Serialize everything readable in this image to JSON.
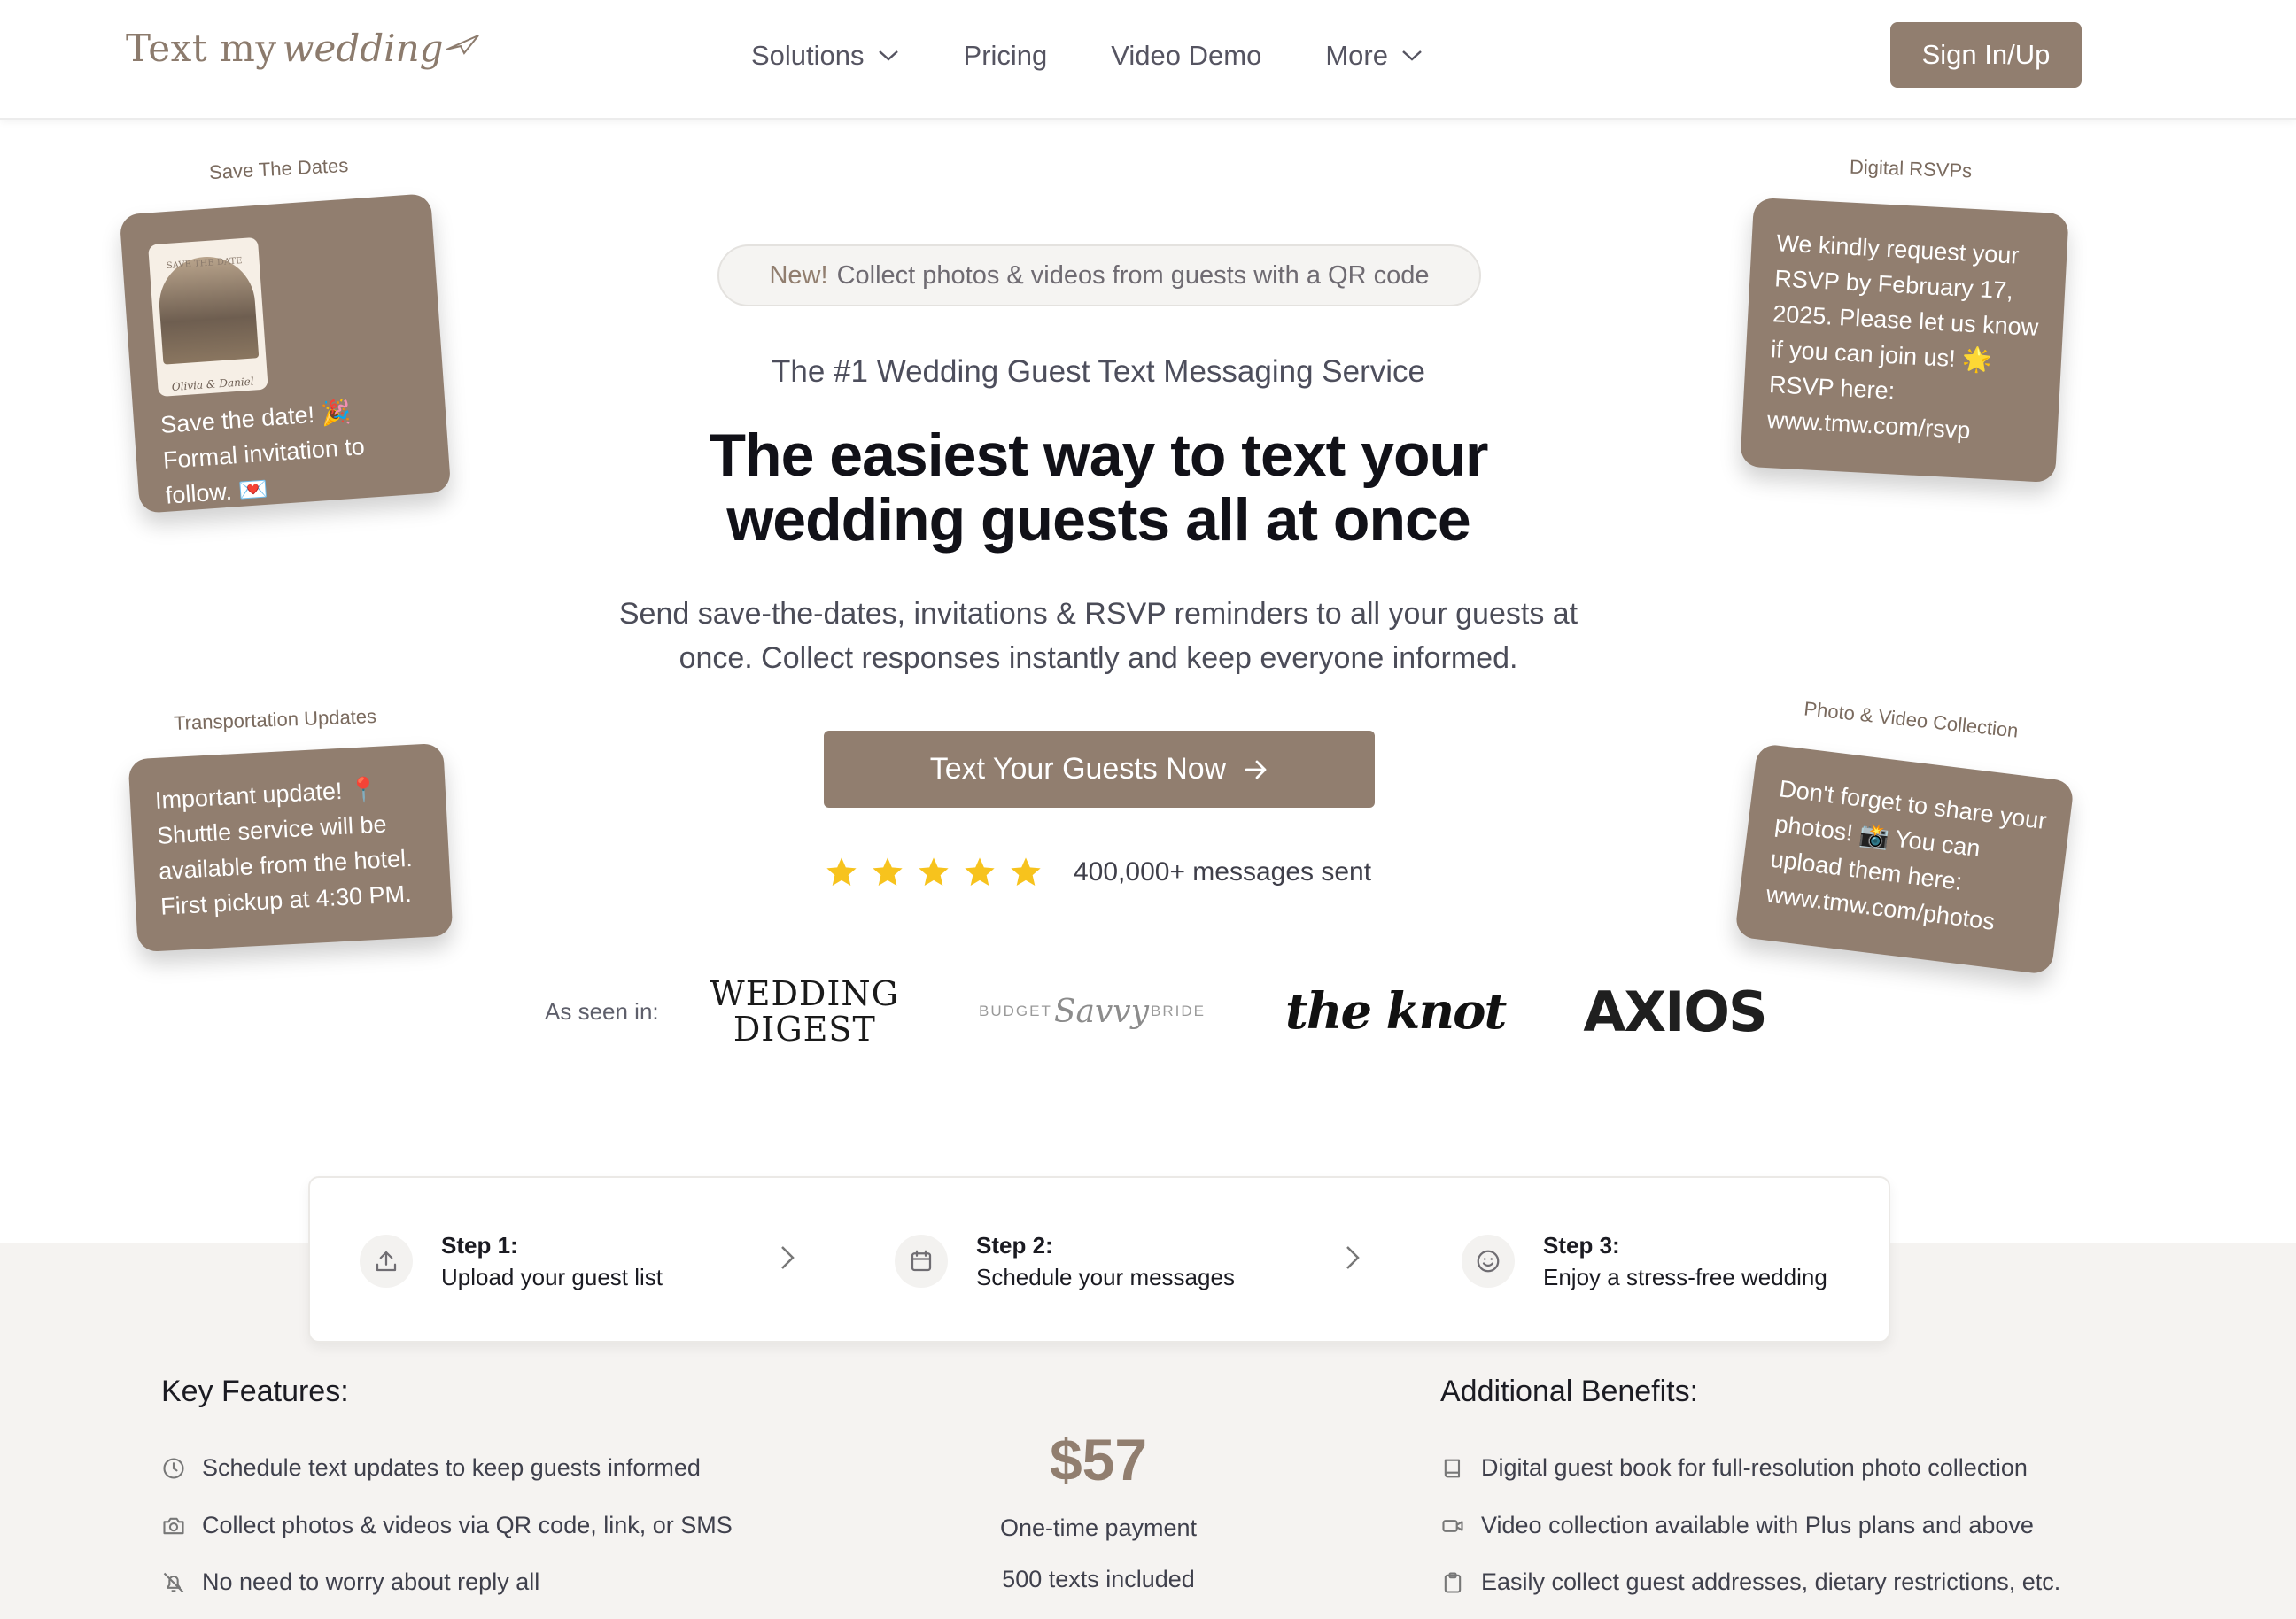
{
  "header": {
    "logo_serif": "Text my",
    "logo_script": "wedding",
    "nav": [
      {
        "label": "Solutions",
        "has_dropdown": true
      },
      {
        "label": "Pricing",
        "has_dropdown": false
      },
      {
        "label": "Video Demo",
        "has_dropdown": false
      },
      {
        "label": "More",
        "has_dropdown": true
      }
    ],
    "signin_label": "Sign In/Up"
  },
  "hero": {
    "badge_new": "New!",
    "badge_text": "Collect photos & videos from guests with a QR code",
    "subtitle": "The #1 Wedding Guest Text Messaging Service",
    "title_line1": "The easiest way to text your",
    "title_line2": "wedding guests all at once",
    "desc_line1": "Send save-the-dates, invitations & RSVP reminders to all your guests at",
    "desc_line2": "once. Collect responses instantly and keep everyone informed.",
    "cta_label": "Text Your Guests Now",
    "stars": 5,
    "rating_text": "400,000+ messages sent"
  },
  "press": {
    "label": "As seen in:",
    "wedding_digest_line1": "WEDDING",
    "wedding_digest_line2": "DIGEST",
    "bsb_left": "BUDGET",
    "bsb_script": "Savvy",
    "bsb_right": "BRIDE",
    "theknot": "the knot",
    "axios": "AXIOS"
  },
  "cards": {
    "save_dates": {
      "label": "Save The Dates",
      "photo_caption": "Olivia & Daniel",
      "photo_header": "SAVE THE DATE",
      "text": "Save the date! 🎉 Formal invitation to follow. 💌"
    },
    "rsvp": {
      "label": "Digital RSVPs",
      "text": "We kindly request your RSVP by February 17, 2025. Please let us know if you can join us! 🌟 RSVP here: www.tmw.com/rsvp"
    },
    "transport": {
      "label": "Transportation Updates",
      "text": "Important update! 📍 Shuttle service will be available from the hotel. First pickup at 4:30 PM."
    },
    "photo": {
      "label": "Photo & Video Collection",
      "text": "Don't forget to share your photos! 📸 You can upload them here: www.tmw.com/photos"
    }
  },
  "steps": [
    {
      "title": "Step 1:",
      "text": "Upload your guest list",
      "icon": "upload-icon"
    },
    {
      "title": "Step 2:",
      "text": "Schedule your messages",
      "icon": "calendar-icon"
    },
    {
      "title": "Step 3:",
      "text": "Enjoy a stress-free wedding",
      "icon": "smile-icon"
    }
  ],
  "features": {
    "heading": "Key Features:",
    "items": [
      {
        "icon": "clock-icon",
        "text": "Schedule text updates to keep guests informed"
      },
      {
        "icon": "camera-icon",
        "text": "Collect photos & videos via QR code, link, or SMS"
      },
      {
        "icon": "bell-off-icon",
        "text": "No need to worry about reply all"
      }
    ]
  },
  "pricing": {
    "amount": "$57",
    "line1": "One-time payment",
    "line2": "500 texts included"
  },
  "benefits": {
    "heading": "Additional Benefits:",
    "items": [
      {
        "icon": "book-icon",
        "text": "Digital guest book for full-resolution photo collection"
      },
      {
        "icon": "video-icon",
        "text": "Video collection available with Plus plans and above"
      },
      {
        "icon": "clipboard-icon",
        "text": "Easily collect guest addresses, dietary restrictions, etc."
      }
    ]
  },
  "colors": {
    "brand": "#917e6f",
    "star": "#f7c31d",
    "lower_bg": "#f5f3f1"
  }
}
